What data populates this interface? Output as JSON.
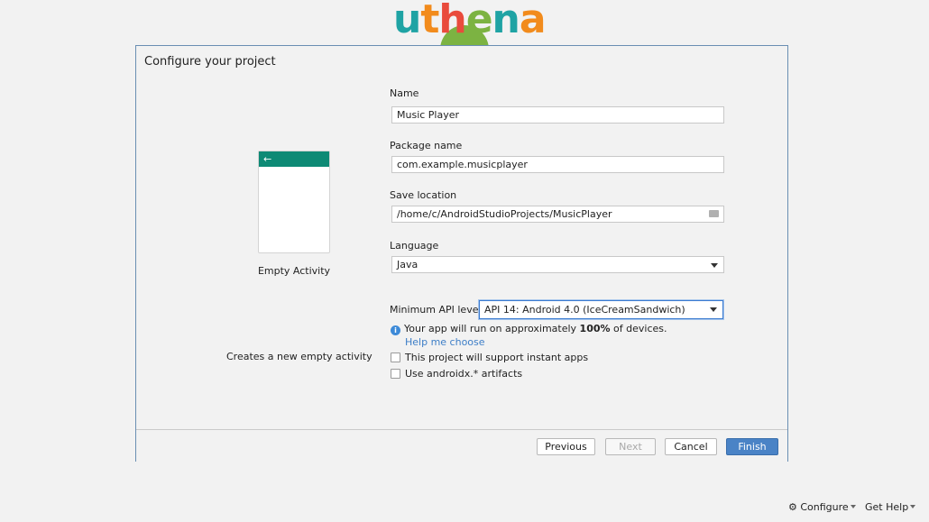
{
  "logo": {
    "letters": [
      "u",
      "t",
      "h",
      "e",
      "n",
      "a"
    ]
  },
  "dialog": {
    "title": "Configure your project",
    "preview_back": "←",
    "activity_name": "Empty Activity",
    "activity_desc": "Creates a new empty activity"
  },
  "form": {
    "name_label": "Name",
    "name_value": "Music Player",
    "package_label": "Package name",
    "package_value": "com.example.musicplayer",
    "location_label": "Save location",
    "location_value": "/home/c/AndroidStudioProjects/MusicPlayer",
    "language_label": "Language",
    "language_value": "Java",
    "api_label": "Minimum API level",
    "api_value": "API 14: Android 4.0 (IceCreamSandwich)",
    "info_icon": "i",
    "info_prefix": "Your app will run on approximately ",
    "info_percent": "100%",
    "info_suffix": " of devices.",
    "help_link": "Help me choose",
    "instant_apps_label": "This project will support instant apps",
    "instant_apps_checked": false,
    "androidx_label": "Use androidx.* artifacts",
    "androidx_checked": false
  },
  "buttons": {
    "previous": "Previous",
    "next": "Next",
    "cancel": "Cancel",
    "finish": "Finish"
  },
  "bottom": {
    "configure": "Configure",
    "get_help": "Get Help"
  },
  "colors": {
    "accent": "#4a83c6",
    "preview_bar": "#0e8a75",
    "link": "#3d7ec7"
  }
}
